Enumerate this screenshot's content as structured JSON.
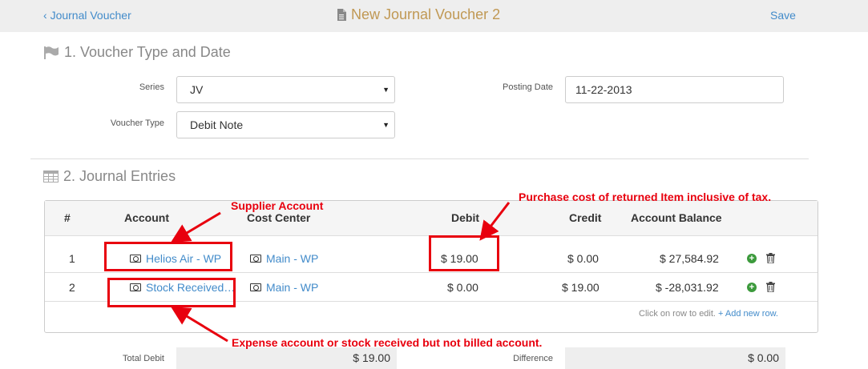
{
  "header": {
    "back_label": "Journal Voucher",
    "title": "New Journal Voucher 2",
    "save_label": "Save"
  },
  "section1": {
    "title": "1. Voucher Type and Date",
    "series_label": "Series",
    "series_value": "JV",
    "voucher_type_label": "Voucher Type",
    "voucher_type_value": "Debit Note",
    "posting_date_label": "Posting Date",
    "posting_date_value": "11-22-2013"
  },
  "section2": {
    "title": "2. Journal Entries",
    "columns": [
      "#",
      "Account",
      "Cost Center",
      "Debit",
      "Credit",
      "Account Balance"
    ],
    "rows": [
      {
        "idx": "1",
        "account": "Helios Air - WP",
        "cost_center": "Main - WP",
        "debit": "$ 19.00",
        "credit": "$ 0.00",
        "balance": "$ 27,584.92"
      },
      {
        "idx": "2",
        "account": "Stock Received…",
        "cost_center": "Main - WP",
        "debit": "$ 0.00",
        "credit": "$ 19.00",
        "balance": "$ -28,031.92"
      }
    ],
    "footer_hint": "Click on row to edit.",
    "add_row_label": "+ Add new row."
  },
  "totals": {
    "total_debit_label": "Total Debit",
    "total_debit_value": "$ 19.00",
    "difference_label": "Difference",
    "difference_value": "$ 0.00"
  },
  "annotations": {
    "supplier": "Supplier Account",
    "purchase": "Purchase cost of returned Item inclusive of tax.",
    "expense": "Expense account or stock received but not billed account.",
    "color": "#e8000e"
  },
  "icons": {
    "title": "file-icon",
    "section1": "flag-icon",
    "section2": "table-icon",
    "account": "money-icon",
    "add": "plus-circle-icon",
    "delete": "trash-icon"
  },
  "colors": {
    "link": "#428bca",
    "title": "#c09853",
    "add_icon": "#3c9a3c"
  }
}
